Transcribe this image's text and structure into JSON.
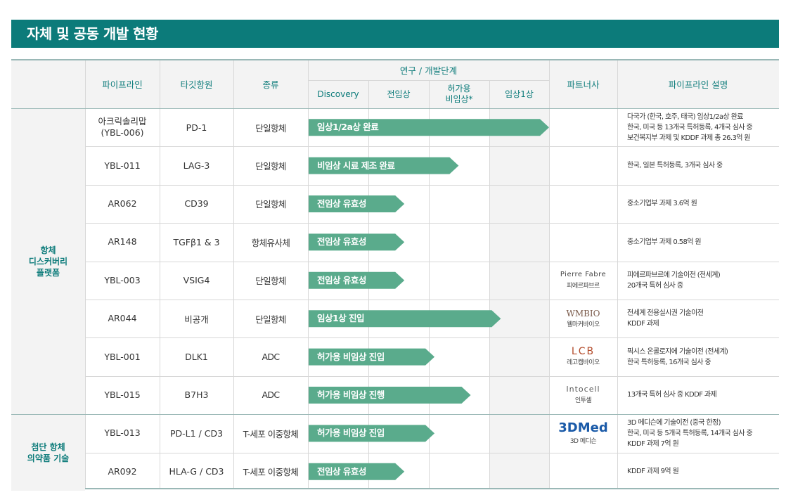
{
  "title": "자체 및 공동 개발 현황",
  "headers": {
    "pipeline": "파이프라인",
    "target": "타깃항원",
    "type": "종류",
    "stage_group": "연구 / 개발단계",
    "stages": [
      "Discovery",
      "전임상",
      "허가용\n비임상*",
      "임상1상"
    ],
    "partner": "파트너사",
    "description": "파이프라인 설명"
  },
  "groups": [
    {
      "label": "항체\n디스커버리\n플랫폼"
    },
    {
      "label": "첨단 항체\n의약품 기술"
    }
  ],
  "rows": [
    {
      "pipeline": "아크릭솔리맙\n(YBL-006)",
      "target": "PD-1",
      "type": "단일항체",
      "status": "임상1/2a상 완료",
      "progress": 4.0,
      "partner": {
        "logo": "",
        "name": ""
      },
      "desc": [
        "다국가 (한국, 호주, 태국) 임상1/2a상 완료",
        "한국, 미국 등 13개국 특허등록, 4개국 심사 중",
        "보건복지부 과제 및 KDDF 과제 총 26.3억 원"
      ]
    },
    {
      "pipeline": "YBL-011",
      "target": "LAG-3",
      "type": "단일항체",
      "status": "비임상 시료 제조 완료",
      "progress": 2.5,
      "partner": {
        "logo": "",
        "name": ""
      },
      "desc": [
        "한국, 일본 특허등록, 3개국 심사 중"
      ]
    },
    {
      "pipeline": "AR062",
      "target": "CD39",
      "type": "단일항체",
      "status": "전임상 유효성",
      "progress": 1.6,
      "partner": {
        "logo": "",
        "name": ""
      },
      "desc": [
        "중소기업부 과제 3.6억 원"
      ]
    },
    {
      "pipeline": "AR148",
      "target": "TGFβ1 & 3",
      "type": "항체유사체",
      "status": "전임상 유효성",
      "progress": 1.6,
      "partner": {
        "logo": "",
        "name": ""
      },
      "desc": [
        "중소기업부 과제 0.58억 원"
      ]
    },
    {
      "pipeline": "YBL-003",
      "target": "VSIG4",
      "type": "단일항체",
      "status": "전임상 유효성",
      "progress": 1.6,
      "partner": {
        "logo": "Pierre Fabre",
        "name": "피에르파브르"
      },
      "desc": [
        "피에르파브르에 기술이전 (전세계)",
        "20개국 특허 심사 중"
      ]
    },
    {
      "pipeline": "AR044",
      "target": "비공개",
      "type": "단일항체",
      "status": "임상1상 진입",
      "progress": 3.2,
      "partner": {
        "logo": "WMBIO",
        "name": "웰마커바이오"
      },
      "desc": [
        "전세계 전용실시권 기술이전",
        "KDDF 과제"
      ]
    },
    {
      "pipeline": "YBL-001",
      "target": "DLK1",
      "type": "ADC",
      "status": "허가용 비임상 진입",
      "progress": 2.1,
      "partner": {
        "logo": "LCB",
        "name": "레고켐바이오"
      },
      "desc": [
        "픽시스 온콜로지에 기술이전 (전세계)",
        "한국 특허등록, 16개국 심사 중"
      ]
    },
    {
      "pipeline": "YBL-015",
      "target": "B7H3",
      "type": "ADC",
      "status": "허가용 비임상 진행",
      "progress": 2.7,
      "partner": {
        "logo": "Intocell",
        "name": "인투셀"
      },
      "desc": [
        "13개국 특허 심사 중 KDDF 과제"
      ]
    },
    {
      "pipeline": "YBL-013",
      "target": "PD-L1 / CD3",
      "type": "T-세포 이중항체",
      "status": "허가용 비임상 진입",
      "progress": 2.1,
      "partner": {
        "logo": "3DMed",
        "name": "3D 메디슨"
      },
      "desc": [
        "3D 메디슨에 기술이전 (중국 한정)",
        "한국, 미국 등 5개국 특허등록, 14개국 심사 중",
        "KDDF 과제 7억 원"
      ]
    },
    {
      "pipeline": "AR092",
      "target": "HLA-G / CD3",
      "type": "T-세포 이중항체",
      "status": "전임상 유효성",
      "progress": 1.6,
      "partner": {
        "logo": "",
        "name": ""
      },
      "desc": [
        "KDDF 과제 9억 원"
      ]
    }
  ],
  "colors": {
    "title_bg": "#0c7b7a",
    "header_text": "#0c7b7a",
    "arrow": "#5aab8c",
    "shade": "#f3f3f3",
    "border": "#9ab8b6"
  }
}
